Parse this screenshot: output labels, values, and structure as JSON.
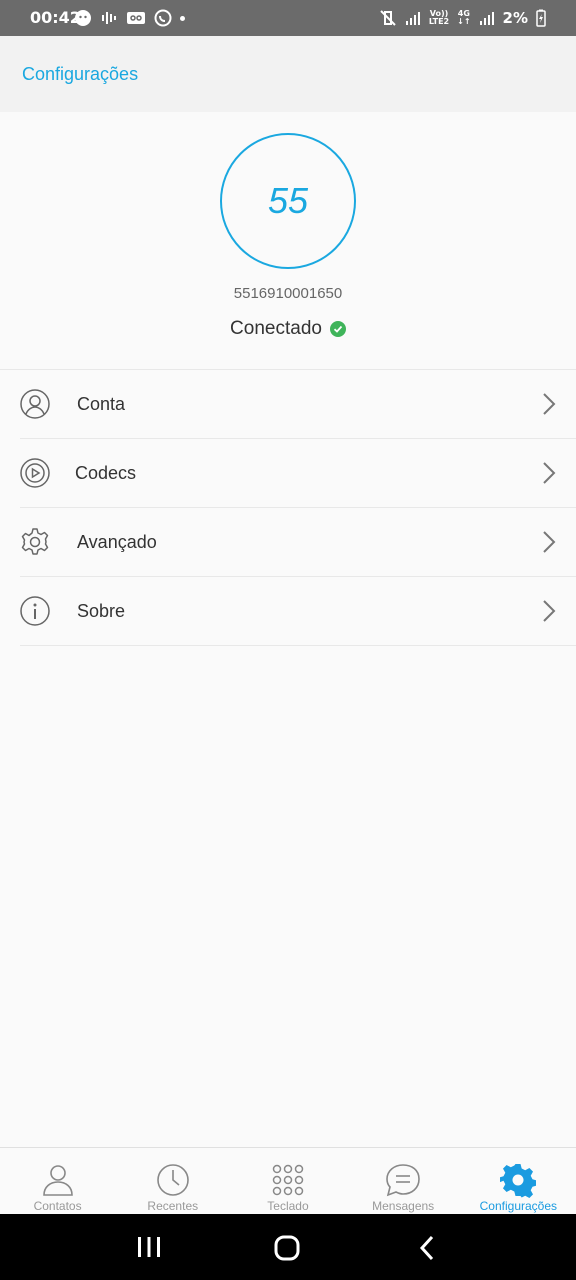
{
  "status_bar": {
    "time": "00:42",
    "battery": "2%",
    "net_top": "Vo))",
    "net_bottom": "LTE2",
    "net4g": "4G"
  },
  "header": {
    "title": "Configurações"
  },
  "profile": {
    "avatar_text": "55",
    "number": "5516910001650",
    "status": "Conectado"
  },
  "menu": [
    {
      "label": "Conta",
      "icon": "person-icon"
    },
    {
      "label": "Codecs",
      "icon": "media-play-icon"
    },
    {
      "label": "Avançado",
      "icon": "gear-icon"
    },
    {
      "label": "Sobre",
      "icon": "info-icon"
    }
  ],
  "bottom_nav": [
    {
      "label": "Contatos",
      "icon": "contact-icon",
      "active": false
    },
    {
      "label": "Recentes",
      "icon": "clock-icon",
      "active": false
    },
    {
      "label": "Teclado",
      "icon": "dialpad-icon",
      "active": false
    },
    {
      "label": "Mensagens",
      "icon": "message-icon",
      "active": false
    },
    {
      "label": "Configurações",
      "icon": "gear-icon",
      "active": true
    }
  ],
  "colors": {
    "accent": "#1aa8e0",
    "connected": "#3fb45a"
  }
}
